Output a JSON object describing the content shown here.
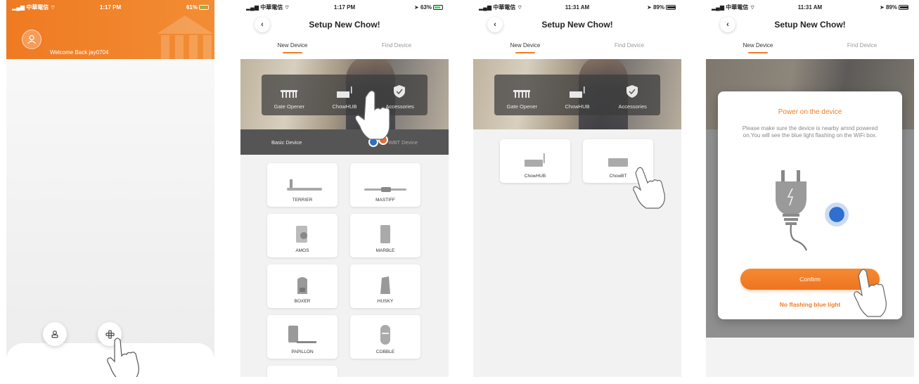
{
  "screens": {
    "welcome": {
      "status": {
        "carrier": "中華電信",
        "time": "1:17 PM",
        "battery": "61%"
      },
      "welcome_text": "Welcome Back jay0704"
    },
    "select_device": {
      "status": {
        "carrier": "中華電信",
        "time": "1:17 PM",
        "battery": "63%"
      },
      "title": "Setup New Chow!",
      "tabs": [
        {
          "label": "New Device",
          "active": true
        },
        {
          "label": "Find Device",
          "active": false
        }
      ],
      "categories": [
        "Gate Opener",
        "ChowHUB",
        "Accessories"
      ],
      "type_left": "Basic Device",
      "type_right": "WBT Device",
      "devices": [
        "TERRIER",
        "MASTIFF",
        "AMOS",
        "MARBLE",
        "BOXER",
        "HUSKY",
        "PAPILLON",
        "COBBLE"
      ]
    },
    "select_hub": {
      "status": {
        "carrier": "中華電信",
        "time": "11:31 AM",
        "battery": "89%"
      },
      "title": "Setup New Chow!",
      "tabs": [
        {
          "label": "New Device",
          "active": true
        },
        {
          "label": "Find Device",
          "active": false
        }
      ],
      "categories": [
        "Gate Opener",
        "ChowHUB",
        "Accessories"
      ],
      "devices": [
        "ChowHUB",
        "ChowBT"
      ]
    },
    "power_on": {
      "status": {
        "carrier": "中華電信",
        "time": "11:31 AM",
        "battery": "89%"
      },
      "title": "Setup New Chow!",
      "tabs": [
        {
          "label": "New Device",
          "active": true
        },
        {
          "label": "Find Device",
          "active": false
        }
      ],
      "modal": {
        "title": "Power on the device",
        "message": "Please make sure the device is nearby amnd powered on.You will see the blue light flashing on the WiFi box.",
        "confirm_label": "Confirm",
        "alt_label": "No flashing blue light"
      }
    }
  },
  "colors": {
    "accent": "#f07d26",
    "blue_light": "#2f6fd0",
    "dark_bar": "#555555"
  }
}
